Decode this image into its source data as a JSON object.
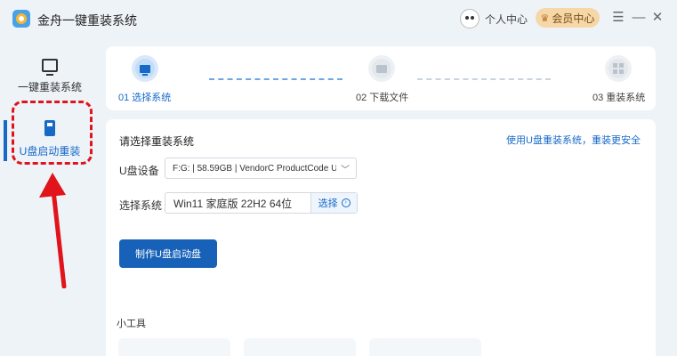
{
  "app": {
    "title": "金舟一键重装系统"
  },
  "header": {
    "user_center": "个人中心",
    "member_center": "会员中心",
    "menu_glyph": "☰",
    "minimize_glyph": "—",
    "close_glyph": "✕"
  },
  "sidebar": {
    "items": [
      {
        "label": "一键重装系统",
        "icon": "monitor-icon",
        "active": false
      },
      {
        "label": "U盘启动重装",
        "icon": "usb-drive-icon",
        "active": true
      }
    ]
  },
  "steps": [
    {
      "label": "01 选择系统",
      "icon": "monitor-icon",
      "active": true
    },
    {
      "label": "02 下载文件",
      "icon": "folder-icon",
      "active": false
    },
    {
      "label": "03 重装系统",
      "icon": "grid-icon",
      "active": false
    }
  ],
  "main": {
    "title": "请选择重装系统",
    "safe_link": "使用U盘重装系统，重装更安全",
    "usb_label": "U盘设备",
    "usb_value": "F:G: | 58.59GB | VendorC ProductCode U...",
    "system_label": "选择系统",
    "system_value": "Win11 家庭版 22H2 64位",
    "select_button": "选择",
    "make_button": "制作U盘启动盘",
    "tools_title": "小工具"
  },
  "colors": {
    "accent": "#1769c8",
    "annotation_red": "#e0141a",
    "member_bg": "#f5d7a8"
  }
}
